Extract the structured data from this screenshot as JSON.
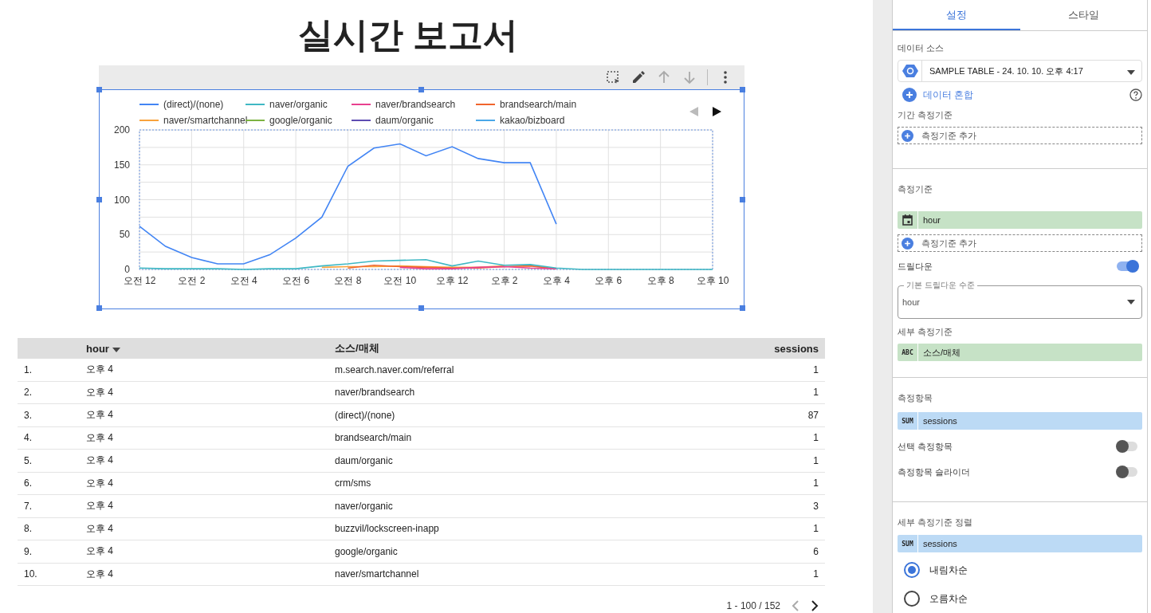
{
  "title": "실시간 보고서",
  "chart": {
    "chart_data": {
      "type": "line",
      "grid": true,
      "legend": true,
      "categories": [
        "오전 12",
        null,
        "오전 2",
        null,
        "오전 4",
        null,
        "오전 6",
        null,
        "오전 8",
        null,
        "오전 10",
        null,
        "오후 12",
        null,
        "오후 2",
        null,
        "오후 4",
        null,
        "오후 6",
        null,
        "오후 8",
        null,
        "오후 10"
      ],
      "yticks": [
        0,
        50,
        100,
        150,
        200
      ],
      "ylim": [
        0,
        200
      ],
      "series": [
        {
          "name": "(direct)/(none)",
          "color": "#4285f4",
          "values": [
            62,
            33,
            17,
            8,
            8,
            21,
            45,
            75,
            148,
            174,
            180,
            163,
            176,
            159,
            153,
            153,
            65,
            null,
            null,
            null,
            null,
            null,
            null
          ]
        },
        {
          "name": "naver/organic",
          "color": "#3fb8c4",
          "values": [
            2,
            1,
            1,
            1,
            0,
            1,
            1,
            5,
            8,
            12,
            13,
            14,
            5,
            12,
            6,
            7,
            2,
            0,
            0,
            0,
            0,
            0,
            0
          ]
        },
        {
          "name": "naver/brandsearch",
          "color": "#e8408f",
          "values": [
            null,
            null,
            null,
            null,
            null,
            null,
            null,
            null,
            null,
            null,
            3,
            1,
            1,
            3,
            4,
            2,
            1,
            null,
            null,
            null,
            null,
            null,
            null
          ]
        },
        {
          "name": "brandsearch/main",
          "color": "#f0652c",
          "values": [
            null,
            null,
            null,
            null,
            null,
            null,
            null,
            null,
            2,
            6,
            4,
            3,
            2,
            2,
            4,
            5,
            1,
            null,
            null,
            null,
            null,
            null,
            null
          ]
        },
        {
          "name": "naver/smartchannel",
          "color": "#f9a23c",
          "values": [
            null,
            null,
            null,
            null,
            null,
            null,
            null,
            3,
            4,
            4,
            5,
            4,
            3,
            3,
            5,
            null,
            null,
            null,
            null,
            null,
            null,
            null,
            null
          ]
        },
        {
          "name": "google/organic",
          "color": "#7cb342",
          "values": [
            null,
            null,
            null,
            null,
            null,
            null,
            null,
            null,
            null,
            null,
            null,
            null,
            null,
            null,
            null,
            null,
            null,
            null,
            null,
            null,
            null,
            null,
            null
          ]
        },
        {
          "name": "daum/organic",
          "color": "#5e4db2",
          "values": [
            null,
            null,
            null,
            null,
            null,
            null,
            null,
            null,
            null,
            null,
            null,
            null,
            null,
            null,
            null,
            null,
            null,
            null,
            null,
            null,
            null,
            null,
            null
          ]
        },
        {
          "name": "kakao/bizboard",
          "color": "#4aa8e8",
          "values": [
            null,
            null,
            null,
            null,
            null,
            null,
            null,
            null,
            null,
            null,
            null,
            null,
            null,
            null,
            null,
            null,
            null,
            null,
            null,
            null,
            null,
            null,
            null
          ]
        }
      ]
    }
  },
  "table": {
    "columns": [
      {
        "label": "hour",
        "sorted": true
      },
      {
        "label": "소스/매체",
        "sorted": false
      },
      {
        "label": "sessions",
        "sorted": false
      }
    ],
    "rows": [
      {
        "number": "1.",
        "cells": [
          "오후 4",
          "m.search.naver.com/referral",
          "1"
        ]
      },
      {
        "number": "2.",
        "cells": [
          "오후 4",
          "naver/brandsearch",
          "1"
        ]
      },
      {
        "number": "3.",
        "cells": [
          "오후 4",
          "(direct)/(none)",
          "87"
        ]
      },
      {
        "number": "4.",
        "cells": [
          "오후 4",
          "brandsearch/main",
          "1"
        ]
      },
      {
        "number": "5.",
        "cells": [
          "오후 4",
          "daum/organic",
          "1"
        ]
      },
      {
        "number": "6.",
        "cells": [
          "오후 4",
          "crm/sms",
          "1"
        ]
      },
      {
        "number": "7.",
        "cells": [
          "오후 4",
          "naver/organic",
          "3"
        ]
      },
      {
        "number": "8.",
        "cells": [
          "오후 4",
          "buzzvil/lockscreen-inapp",
          "1"
        ]
      },
      {
        "number": "9.",
        "cells": [
          "오후 4",
          "google/organic",
          "6"
        ]
      },
      {
        "number": "10.",
        "cells": [
          "오후 4",
          "naver/smartchannel",
          "1"
        ]
      }
    ],
    "pagination": "1 - 100 / 152"
  },
  "panel": {
    "tabs": [
      {
        "label": "설정",
        "selected": true
      },
      {
        "label": "스타일",
        "selected": false
      }
    ],
    "data_source": {
      "label": "데이터 소스",
      "value": "SAMPLE TABLE - 24. 10. 10. 오후 4:17",
      "blend": "데이터 혼합"
    },
    "date_dimension": {
      "label": "기간 측정기준",
      "add": "측정기준 추가"
    },
    "dimension": {
      "label": "측정기준",
      "chip": {
        "kind": "date_dimension",
        "text": "hour"
      },
      "add": "측정기준 추가"
    },
    "drilldown": {
      "label": "드릴다운",
      "on": true,
      "level_label": "기본 드릴다운 수준",
      "level_value": "hour"
    },
    "breakdown": {
      "label": "세부 측정기준",
      "chip": {
        "kind": "text_dimension",
        "badge": "ABC",
        "text": "소스/매체"
      }
    },
    "metric": {
      "label": "측정항목",
      "chip": {
        "kind": "metric",
        "badge": "SUM",
        "text": "sessions"
      },
      "toggles": [
        {
          "label": "선택 측정항목",
          "on": false
        },
        {
          "label": "측정항목 슬라이더",
          "on": false
        }
      ]
    },
    "sort": {
      "label": "세부 측정기준 정렬",
      "chip": {
        "kind": "metric",
        "badge": "SUM",
        "text": "sessions"
      },
      "options": [
        {
          "label": "내림차순",
          "selected": true
        },
        {
          "label": "오름차순",
          "selected": false
        }
      ]
    }
  }
}
